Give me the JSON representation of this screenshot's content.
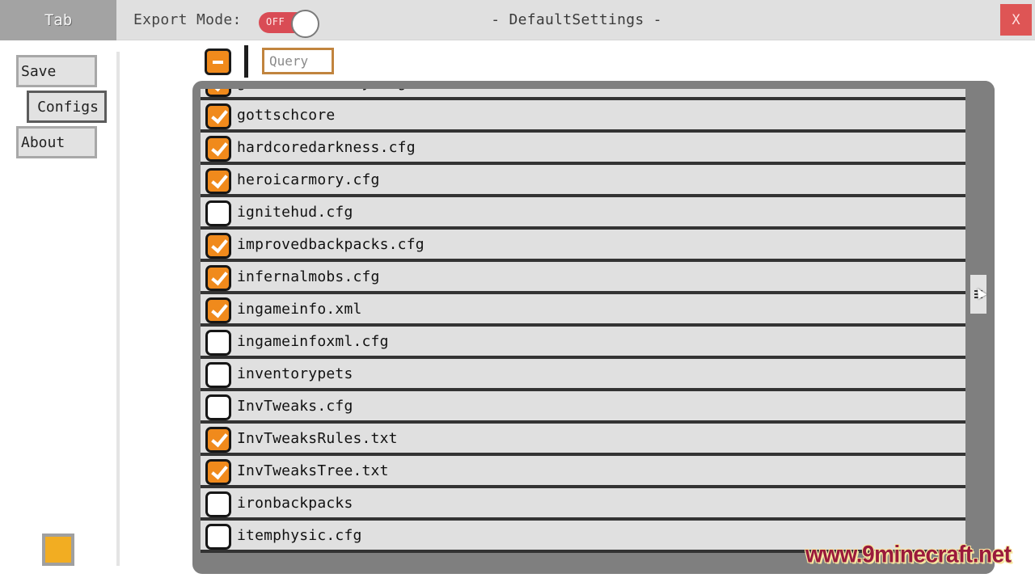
{
  "header": {
    "tab_label": "Tab",
    "export_mode_label": "Export Mode:",
    "export_mode_toggle": {
      "state": "OFF",
      "on": false
    },
    "title": "- DefaultSettings -",
    "close_label": "X"
  },
  "sidebar": {
    "items": [
      {
        "label": "Save",
        "active": false
      },
      {
        "label": "Configs",
        "active": true
      },
      {
        "label": "About",
        "active": false
      }
    ],
    "swatch_color": "#f2ad22"
  },
  "toolbar": {
    "select_all_icon": "minus-icon",
    "query_value": "",
    "query_placeholder": "Query"
  },
  "config_list": {
    "items": [
      {
        "name": "giacomosfoundry.cfg",
        "checked": true
      },
      {
        "name": "gottschcore",
        "checked": true
      },
      {
        "name": "hardcoredarkness.cfg",
        "checked": true
      },
      {
        "name": "heroicarmory.cfg",
        "checked": true
      },
      {
        "name": "ignitehud.cfg",
        "checked": false
      },
      {
        "name": "improvedbackpacks.cfg",
        "checked": true
      },
      {
        "name": "infernalmobs.cfg",
        "checked": true
      },
      {
        "name": "ingameinfo.xml",
        "checked": true
      },
      {
        "name": "ingameinfoxml.cfg",
        "checked": false
      },
      {
        "name": "inventorypets",
        "checked": false
      },
      {
        "name": "InvTweaks.cfg",
        "checked": false
      },
      {
        "name": "InvTweaksRules.txt",
        "checked": true
      },
      {
        "name": "InvTweaksTree.txt",
        "checked": true
      },
      {
        "name": "ironbackpacks",
        "checked": false
      },
      {
        "name": "itemphysic.cfg",
        "checked": false
      }
    ]
  },
  "colors": {
    "accent_orange": "#f08a1c",
    "toggle_off_red": "#d94c55",
    "close_red": "#de5555"
  },
  "watermark": "www.9minecraft.net"
}
